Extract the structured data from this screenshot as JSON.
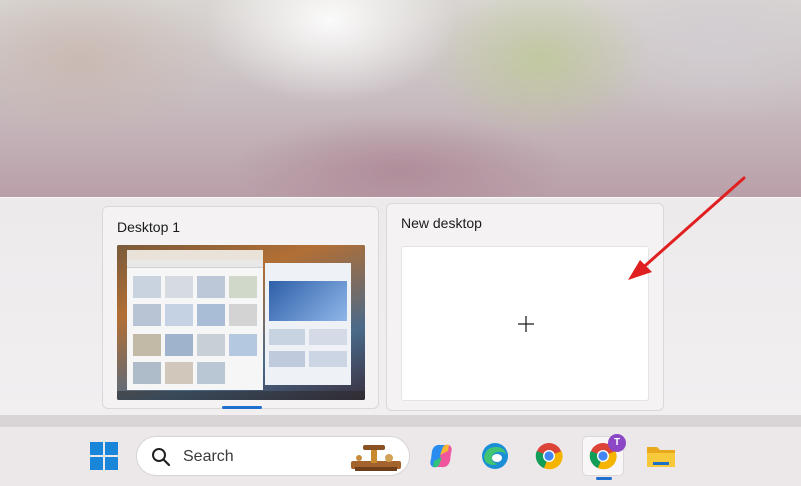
{
  "task_view": {
    "desktops": [
      {
        "label": "Desktop 1",
        "active": true
      },
      {
        "label": "New desktop",
        "active": false
      }
    ]
  },
  "taskbar": {
    "search_placeholder": "Search",
    "items": [
      {
        "name": "start",
        "icon": "windows-logo-icon"
      },
      {
        "name": "copilot",
        "icon": "copilot-icon"
      },
      {
        "name": "edge",
        "icon": "edge-icon"
      },
      {
        "name": "chrome",
        "icon": "chrome-icon"
      },
      {
        "name": "chrome-profile",
        "icon": "chrome-icon",
        "badge": "T",
        "active": true
      },
      {
        "name": "file-explorer",
        "icon": "folder-icon"
      }
    ]
  },
  "colors": {
    "accent": "#1f6fce",
    "arrow": "#e02020",
    "badge": "#8b47c6"
  }
}
